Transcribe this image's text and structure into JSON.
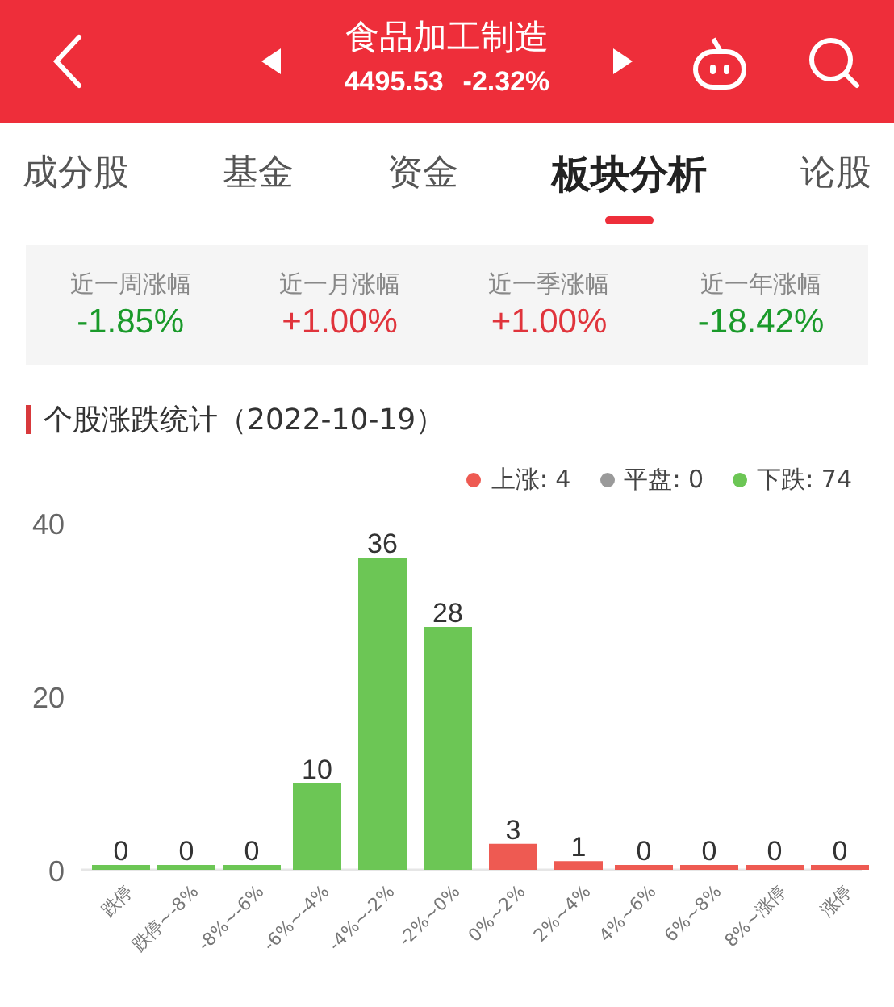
{
  "header": {
    "title": "食品加工制造",
    "price": "4495.53",
    "change": "-2.32%"
  },
  "tabs": [
    {
      "label": "成分股",
      "selected": false
    },
    {
      "label": "基金",
      "selected": false
    },
    {
      "label": "资金",
      "selected": false
    },
    {
      "label": "板块分析",
      "selected": true
    },
    {
      "label": "论股",
      "selected": false
    }
  ],
  "stats": [
    {
      "label": "近一周涨幅",
      "value": "-1.85%",
      "color": "#1a9a2a"
    },
    {
      "label": "近一月涨幅",
      "value": "+1.00%",
      "color": "#e0343c"
    },
    {
      "label": "近一季涨幅",
      "value": "+1.00%",
      "color": "#e0343c"
    },
    {
      "label": "近一年涨幅",
      "value": "-18.42%",
      "color": "#1a9a2a"
    }
  ],
  "section_title": "个股涨跌统计（2022-10-19）",
  "legend": [
    {
      "label": "上涨: 4",
      "color": "#ee5a52"
    },
    {
      "label": "平盘: 0",
      "color": "#9a9a9a"
    },
    {
      "label": "下跌: 74",
      "color": "#6cc655"
    }
  ],
  "chart_data": {
    "type": "bar",
    "categories": [
      "跌停",
      "跌停~-8%",
      "-8%~-6%",
      "-6%~-4%",
      "-4%~-2%",
      "-2%~0%",
      "0%~2%",
      "2%~4%",
      "4%~6%",
      "6%~8%",
      "8%~涨停",
      "涨停"
    ],
    "series": [
      {
        "color": "#6cc655",
        "values": [
          0,
          0,
          0,
          10,
          36,
          28,
          null,
          null,
          null,
          null,
          null,
          null
        ]
      },
      {
        "color": "#ee5a52",
        "values": [
          null,
          null,
          null,
          null,
          null,
          null,
          3,
          1,
          0,
          0,
          0,
          0
        ]
      }
    ],
    "ylim": [
      0,
      40
    ],
    "yticks": [
      0,
      20,
      40
    ],
    "data_labels": true
  }
}
